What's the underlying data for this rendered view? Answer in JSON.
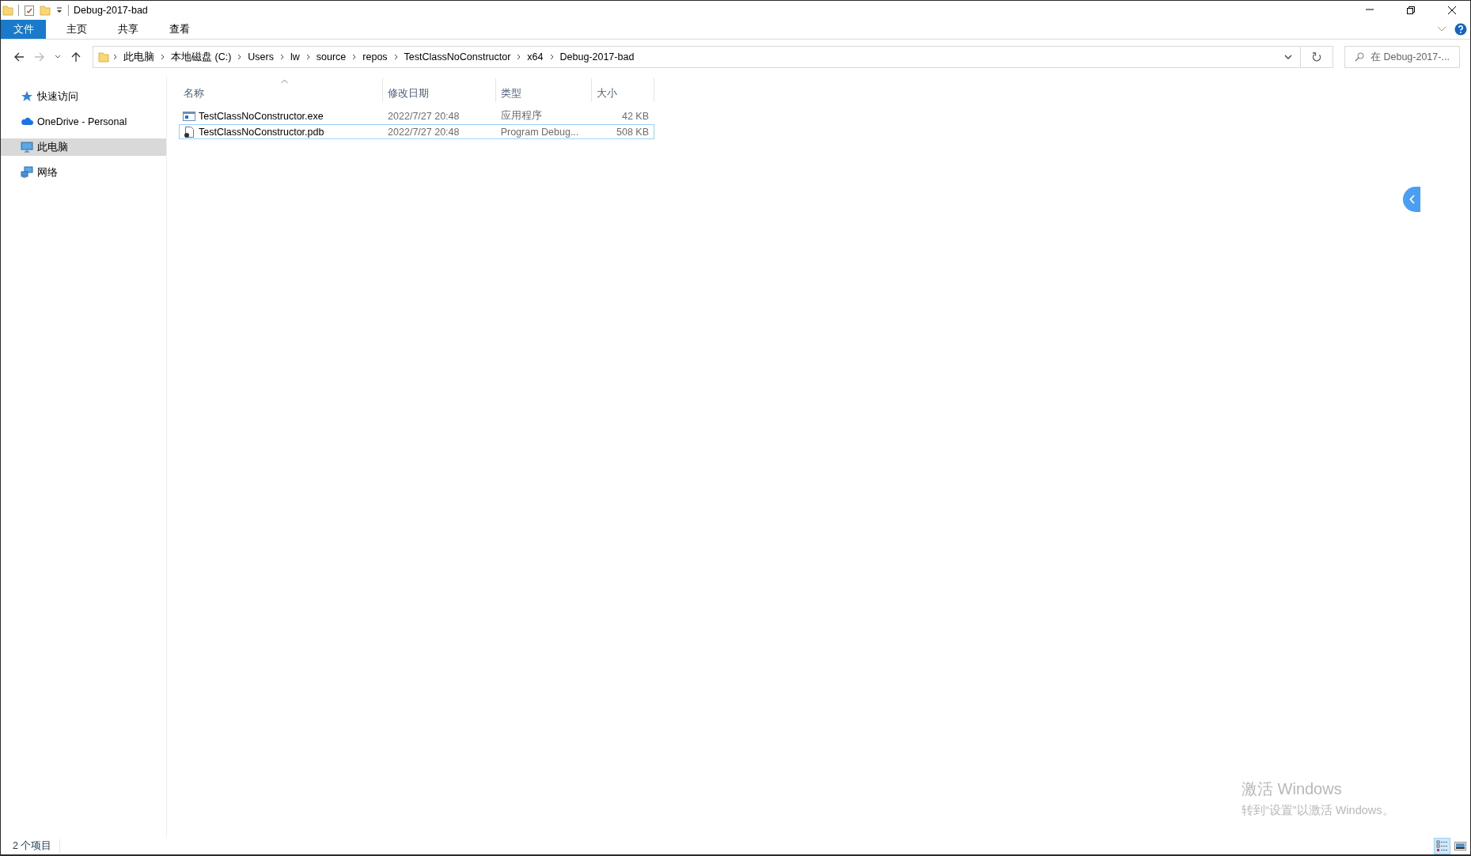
{
  "window": {
    "title": "Debug-2017-bad"
  },
  "ribbon_tabs": [
    {
      "label": "文件",
      "kind": "file"
    },
    {
      "label": "主页",
      "kind": "tab"
    },
    {
      "label": "共享",
      "kind": "tab"
    },
    {
      "label": "查看",
      "kind": "tab"
    }
  ],
  "address_bar": {
    "breadcrumbs": [
      "此电脑",
      "本地磁盘 (C:)",
      "Users",
      "lw",
      "source",
      "repos",
      "TestClassNoConstructor",
      "x64",
      "Debug-2017-bad"
    ]
  },
  "search": {
    "placeholder": "在 Debug-2017-..."
  },
  "nav_items": [
    {
      "label": "快速访问",
      "kind": "star",
      "selected": false
    },
    {
      "label": "OneDrive - Personal",
      "kind": "cloud",
      "selected": false
    },
    {
      "label": "此电脑",
      "kind": "computer",
      "selected": true
    },
    {
      "label": "网络",
      "kind": "network",
      "selected": false
    }
  ],
  "columns": [
    {
      "label": "名称",
      "sorted": true
    },
    {
      "label": "修改日期",
      "sorted": false
    },
    {
      "label": "类型",
      "sorted": false
    },
    {
      "label": "大小",
      "sorted": false
    }
  ],
  "files": [
    {
      "name": "TestClassNoConstructor.exe",
      "modified": "2022/7/27 20:48",
      "type": "应用程序",
      "size": "42 KB",
      "kind": "exe",
      "focused": false
    },
    {
      "name": "TestClassNoConstructor.pdb",
      "modified": "2022/7/27 20:48",
      "type": "Program Debug...",
      "size": "508 KB",
      "kind": "pdb",
      "focused": true
    }
  ],
  "status_bar": {
    "item_count": "2 个项目"
  },
  "view_buttons": [
    {
      "kind": "details",
      "selected": true
    },
    {
      "kind": "large-icons",
      "selected": false
    }
  ],
  "activation_notice": {
    "title": "激活 Windows",
    "subtitle": "转到“设置”以激活 Windows。"
  }
}
